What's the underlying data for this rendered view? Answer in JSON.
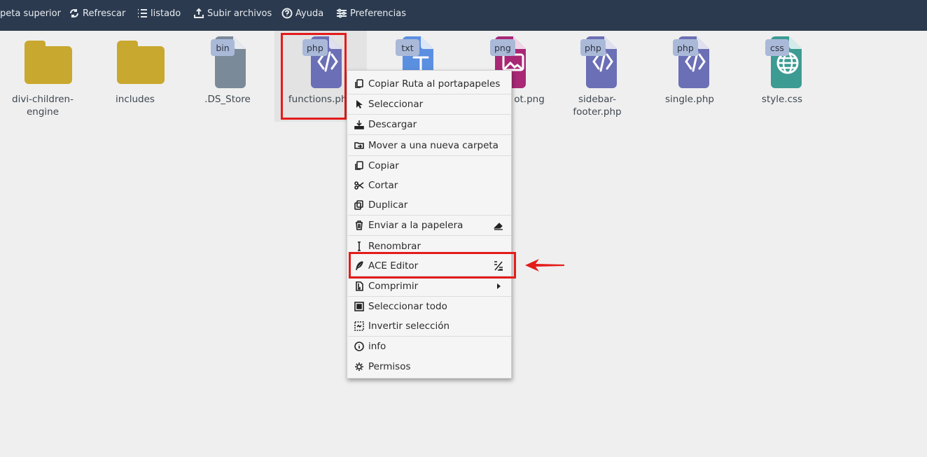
{
  "toolbar": {
    "items": [
      {
        "label": "peta superior",
        "icon": "folder-up-icon"
      },
      {
        "label": "Refrescar",
        "icon": "refresh-icon"
      },
      {
        "label": "listado",
        "icon": "list-icon"
      },
      {
        "label": "Subir archivos",
        "icon": "upload-icon"
      },
      {
        "label": "Ayuda",
        "icon": "help-icon"
      },
      {
        "label": "Preferencias",
        "icon": "sliders-icon"
      }
    ]
  },
  "files": [
    {
      "name": "divi-children-engine",
      "type": "folder",
      "color": "#c9a82f"
    },
    {
      "name": "includes",
      "type": "folder",
      "color": "#c9a82f"
    },
    {
      "name": ".DS_Store",
      "type": "file",
      "ext": "bin",
      "color": "#7b8a99"
    },
    {
      "name": "functions.php",
      "type": "file",
      "ext": "php",
      "color": "#6b6fb5",
      "selected": true
    },
    {
      "name": "",
      "type": "file",
      "ext": "txt",
      "color": "#5b8fe0"
    },
    {
      "name": "ot.png",
      "type": "file",
      "ext": "png",
      "color": "#a82875"
    },
    {
      "name": "sidebar-footer.php",
      "type": "file",
      "ext": "php",
      "color": "#6b6fb5"
    },
    {
      "name": "single.php",
      "type": "file",
      "ext": "php",
      "color": "#6b6fb5"
    },
    {
      "name": "style.css",
      "type": "file",
      "ext": "css",
      "color": "#3c9b93"
    }
  ],
  "context_menu": {
    "items": [
      {
        "label": "Copiar Ruta al portapapeles",
        "icon": "copy-icon"
      },
      {
        "label": "Seleccionar",
        "icon": "cursor-icon"
      },
      {
        "label": "Descargar",
        "icon": "download-icon"
      },
      {
        "label": "Mover a una nueva carpeta",
        "icon": "move-folder-icon"
      },
      {
        "label": "Copiar",
        "icon": "copy-icon"
      },
      {
        "label": "Cortar",
        "icon": "scissors-icon"
      },
      {
        "label": "Duplicar",
        "icon": "duplicate-icon"
      },
      {
        "label": "Enviar a la papelera",
        "icon": "trash-icon",
        "right_icon": "eraser-icon"
      },
      {
        "label": "Renombrar",
        "icon": "text-cursor-icon"
      },
      {
        "label": "ACE Editor",
        "icon": "quill-icon",
        "right_icon": "code-edit-icon"
      },
      {
        "label": "Comprimir",
        "icon": "archive-icon",
        "right_icon": "submenu-arrow-icon"
      },
      {
        "label": "Seleccionar todo",
        "icon": "select-all-icon"
      },
      {
        "label": "Invertir selección",
        "icon": "invert-selection-icon"
      },
      {
        "label": "info",
        "icon": "info-icon"
      },
      {
        "label": "Permisos",
        "icon": "gear-icon"
      }
    ]
  },
  "accent_colors": {
    "toolbar_bg": "#2b3a4f",
    "highlight": "#e41b1b"
  }
}
